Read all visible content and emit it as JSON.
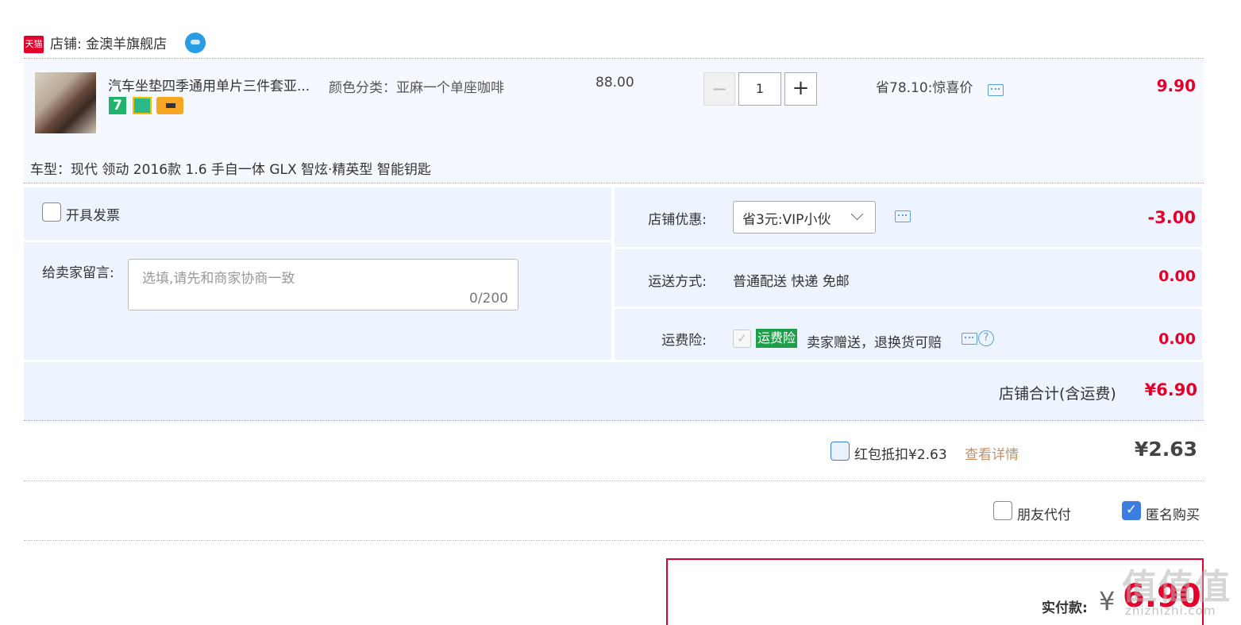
{
  "shop": {
    "platform_logo": "天猫",
    "name_label": "店铺: 金澳羊旗舰店",
    "chat_icon": "wangwang-icon"
  },
  "item": {
    "title": "汽车坐垫四季通用单片三件套亚...",
    "sku": "颜色分类：亚麻一个单座咖啡",
    "badge_7": "7",
    "original_price": "88.00",
    "quantity": "1",
    "qty_minus": "−",
    "qty_plus": "+",
    "promo": "省78.10:惊喜价",
    "unit_price": "9.90",
    "car_model": "车型：现代 领动 2016款 1.6 手自一体 GLX 智炫·精英型 智能钥匙"
  },
  "options": {
    "invoice_label": "开具发票",
    "message_label": "给卖家留言:",
    "message_placeholder": "选填,请先和商家协商一致",
    "message_count": "0/200",
    "coupon_label": "店铺优惠:",
    "coupon_value": "省3元:VIP小伙",
    "coupon_amount": "-3.00",
    "shipping_label": "运送方式:",
    "shipping_value": "普通配送 快递 免邮",
    "shipping_amount": "0.00",
    "insurance_label": "运费险:",
    "insurance_tag": "运费险",
    "insurance_desc": "卖家赠送，退换货可赔",
    "insurance_amount": "0.00",
    "help": "?"
  },
  "total": {
    "label": "店铺合计(含运费)",
    "value": "¥6.90"
  },
  "red_packet": {
    "label": "红包抵扣¥2.63",
    "link": "查看详情",
    "value": "¥2.63"
  },
  "extras": {
    "friend_pay": "朋友代付",
    "anonymous": "匿名购买",
    "anonymous_checked": "✓"
  },
  "payment": {
    "label": "实付款:",
    "currency": "¥",
    "value": "6.90"
  },
  "watermark": {
    "text": "值值值",
    "url": "zhizhizhi.com"
  },
  "colors": {
    "accent_red": "#e4002b",
    "panel_blue": "#eef4fe",
    "link_brown": "#c0906a",
    "checkbox_blue": "#3b7de0",
    "insurance_green": "#1f9e4a"
  }
}
